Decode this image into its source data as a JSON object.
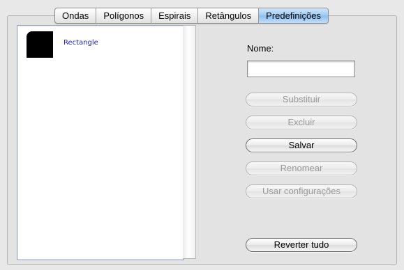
{
  "tabs": [
    {
      "label": "Ondas",
      "active": false
    },
    {
      "label": "Polígonos",
      "active": false
    },
    {
      "label": "Espirais",
      "active": false
    },
    {
      "label": "Retângulos",
      "active": false
    },
    {
      "label": "Predefinições",
      "active": true
    }
  ],
  "presets": {
    "items": [
      {
        "label": "Rectangle",
        "thumb_icon": "rounded-rectangle-icon",
        "thumb_color": "#000000"
      }
    ]
  },
  "form": {
    "name_label": "Nome:",
    "name_value": "",
    "name_placeholder": ""
  },
  "buttons": {
    "replace": {
      "label": "Substituir",
      "enabled": false
    },
    "delete": {
      "label": "Excluir",
      "enabled": false
    },
    "save": {
      "label": "Salvar",
      "enabled": true
    },
    "rename": {
      "label": "Renomear",
      "enabled": false
    },
    "use_settings": {
      "label": "Usar configurações",
      "enabled": false
    },
    "revert_all": {
      "label": "Reverter tudo",
      "enabled": true
    }
  },
  "colors": {
    "active_tab": "#9ec9f1",
    "preset_label": "#1e22b8",
    "disabled_text": "#9a9a9a"
  }
}
